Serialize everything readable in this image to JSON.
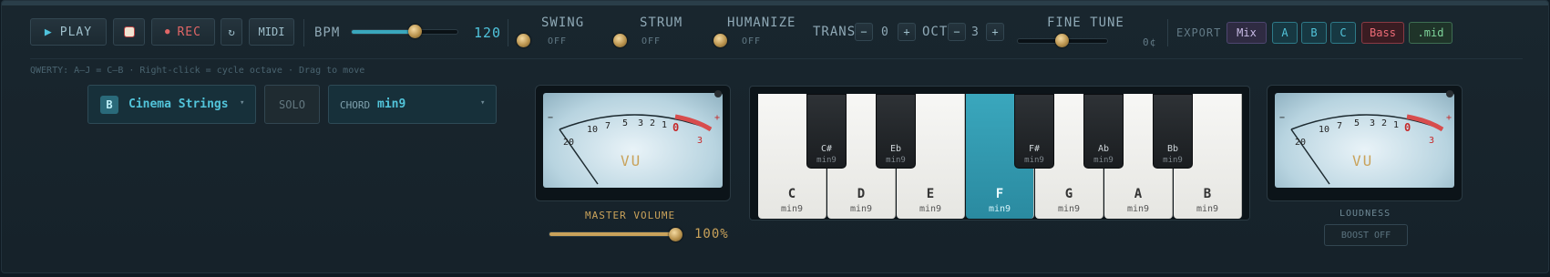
{
  "transport": {
    "play_label": "PLAY",
    "drum_icon": "drum-icon",
    "rec_label": "REC",
    "loop_icon": "loop-icon",
    "midi_label": "MIDI"
  },
  "bpm": {
    "label": "BPM",
    "value": "120",
    "level": 0.63
  },
  "swing": {
    "label": "SWING",
    "state": "OFF"
  },
  "strum": {
    "label": "STRUM",
    "state": "OFF"
  },
  "humanize": {
    "label": "HUMANIZE",
    "state": "OFF"
  },
  "trans": {
    "label": "TRANS",
    "minus": "−",
    "value": "0",
    "plus": "+"
  },
  "oct": {
    "label": "OCT",
    "minus": "−",
    "value": "3",
    "plus": "+"
  },
  "fine_tune": {
    "label": "FINE TUNE",
    "value": "0¢",
    "level": 0.5
  },
  "export": {
    "label": "EXPORT",
    "buttons": [
      "Mix",
      "A",
      "B",
      "C",
      "Bass",
      ".mid"
    ]
  },
  "hint": "QWERTY: A–J = C–B · Right-click = cycle octave · Drag to move",
  "instrument": {
    "slot": "B",
    "name": "Cinema Strings",
    "arrow": "▾"
  },
  "solo_label": "SOLO",
  "chord": {
    "label": "CHORD",
    "value": "min9",
    "arrow": "▾"
  },
  "vu": {
    "label": "VU",
    "scale": [
      "20",
      "10",
      "7",
      "5",
      "3",
      "2",
      "1",
      "0",
      "3"
    ],
    "minus": "−",
    "plus": "+"
  },
  "master_volume": {
    "label": "MASTER VOLUME",
    "value": "100%",
    "level": 1.0
  },
  "keys": {
    "white": [
      {
        "note": "C",
        "chord": "min9"
      },
      {
        "note": "D",
        "chord": "min9"
      },
      {
        "note": "E",
        "chord": "min9"
      },
      {
        "note": "F",
        "chord": "min9"
      },
      {
        "note": "G",
        "chord": "min9"
      },
      {
        "note": "A",
        "chord": "min9"
      },
      {
        "note": "B",
        "chord": "min9"
      }
    ],
    "black": [
      {
        "note": "C#",
        "chord": "min9"
      },
      {
        "note": "Eb",
        "chord": "min9"
      },
      {
        "note": "F#",
        "chord": "min9"
      },
      {
        "note": "Ab",
        "chord": "min9"
      },
      {
        "note": "Bb",
        "chord": "min9"
      }
    ],
    "active": "F"
  },
  "loudness": {
    "label": "LOUDNESS",
    "boost_label": "BOOST OFF"
  },
  "colors": {
    "accent": "#3aa7bd",
    "rec": "#e06666",
    "gold": "#c9a25a"
  }
}
